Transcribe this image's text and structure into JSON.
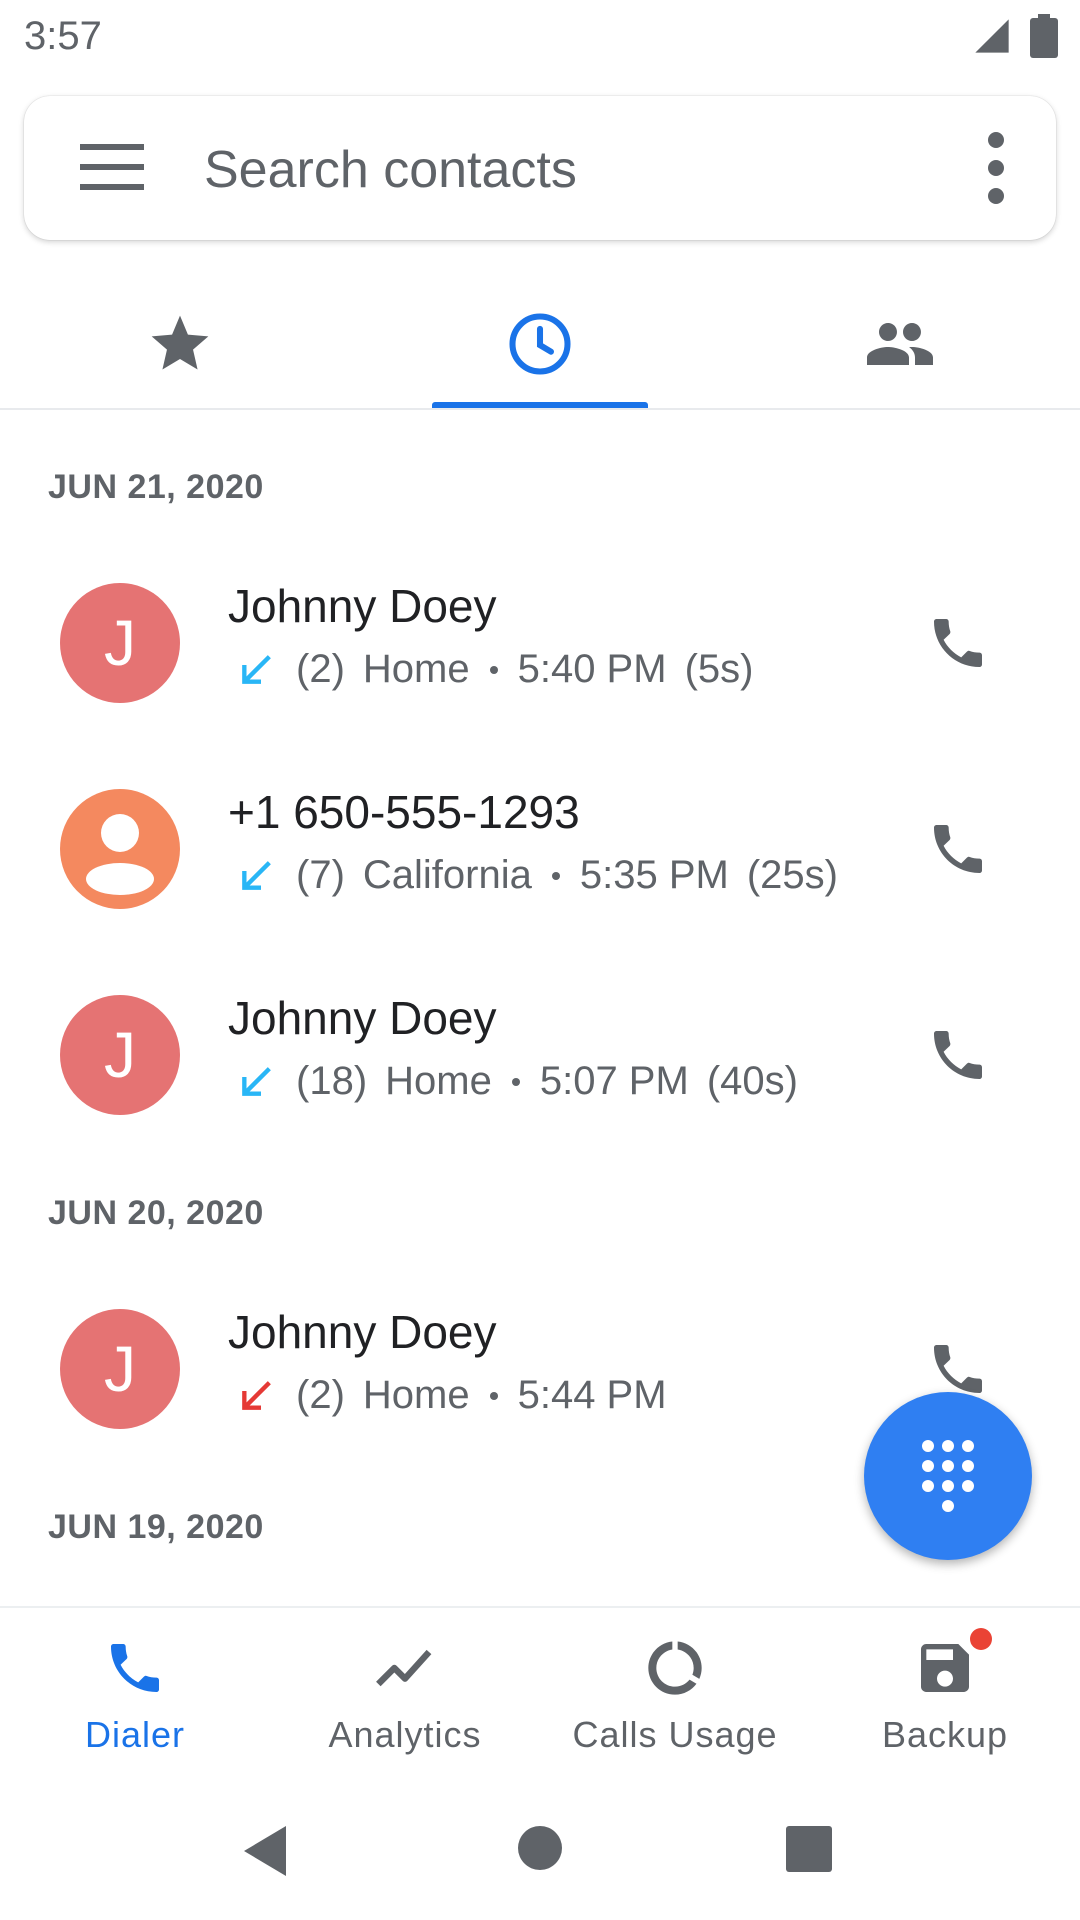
{
  "status_bar": {
    "time": "3:57"
  },
  "search": {
    "placeholder": "Search contacts"
  },
  "tabs": [
    {
      "name": "favorites",
      "icon": "star-icon",
      "active": false
    },
    {
      "name": "recents",
      "icon": "clock-icon",
      "active": true
    },
    {
      "name": "contacts",
      "icon": "people-icon",
      "active": false
    }
  ],
  "colors": {
    "accent": "#1a73e8",
    "fab": "#2f7ff2",
    "avatar_j": "#e57373",
    "avatar_unknown": "#f4895f",
    "incoming": "#29b6f6",
    "missed": "#e53935"
  },
  "groups": [
    {
      "date": "JUN 21, 2020",
      "calls": [
        {
          "name": "Johnny Doey",
          "avatar": "J",
          "type": "incoming",
          "count": "(2)",
          "label": "Home",
          "time": "5:40 PM",
          "duration": "(5s)"
        },
        {
          "name": "+1 650-555-1293",
          "avatar": "person",
          "type": "incoming",
          "count": "(7)",
          "label": "California",
          "time": "5:35 PM",
          "duration": "(25s)"
        },
        {
          "name": "Johnny Doey",
          "avatar": "J",
          "type": "incoming",
          "count": "(18)",
          "label": "Home",
          "time": "5:07 PM",
          "duration": "(40s)"
        }
      ]
    },
    {
      "date": "JUN 20, 2020",
      "calls": [
        {
          "name": "Johnny Doey",
          "avatar": "J",
          "type": "missed",
          "count": "(2)",
          "label": "Home",
          "time": "5:44 PM",
          "duration": ""
        }
      ]
    },
    {
      "date": "JUN 19, 2020",
      "calls": []
    }
  ],
  "bottom_nav": [
    {
      "label": "Dialer",
      "icon": "phone-icon",
      "active": true
    },
    {
      "label": "Analytics",
      "icon": "trending-icon",
      "active": false
    },
    {
      "label": "Calls Usage",
      "icon": "donut-icon",
      "active": false
    },
    {
      "label": "Backup",
      "icon": "save-icon",
      "active": false,
      "badge": true
    }
  ]
}
